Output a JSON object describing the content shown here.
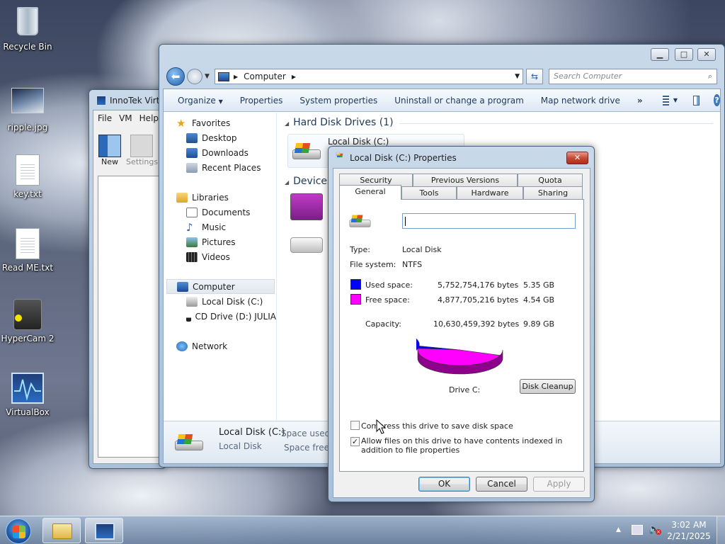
{
  "desktop": {
    "icons": [
      {
        "name": "Recycle Bin"
      },
      {
        "name": "ripple.jpg"
      },
      {
        "name": "key.txt"
      },
      {
        "name": "Read ME.txt"
      },
      {
        "name": "HyperCam 2"
      },
      {
        "name": "VirtualBox"
      }
    ]
  },
  "vbox": {
    "title": "InnoTek Virt",
    "menu": [
      "File",
      "VM",
      "Help"
    ],
    "toolbar": [
      "New",
      "Settings"
    ]
  },
  "explorer": {
    "address": [
      "Computer"
    ],
    "search_placeholder": "Search Computer",
    "toolbar": [
      "Organize",
      "Properties",
      "System properties",
      "Uninstall or change a program",
      "Map network drive"
    ],
    "more": "»",
    "nav": {
      "favorites": "Favorites",
      "favorites_items": [
        "Desktop",
        "Downloads",
        "Recent Places"
      ],
      "libraries": "Libraries",
      "libraries_items": [
        "Documents",
        "Music",
        "Pictures",
        "Videos"
      ],
      "computer": "Computer",
      "computer_items": [
        "Local Disk (C:)",
        "CD Drive (D:) JULIA"
      ],
      "network": "Network"
    },
    "groups": {
      "hdd": "Hard Disk Drives (1)",
      "devices": "Devices"
    },
    "drive_label": "Local Disk (C:)",
    "details": {
      "name": "Local Disk (C:)",
      "type": "Local Disk",
      "space_used_label": "Space used:",
      "space_free_label": "Space free:"
    }
  },
  "dialog": {
    "title": "Local Disk (C:) Properties",
    "tabs_row1": [
      "Security",
      "Previous Versions",
      "Quota"
    ],
    "tabs_row2": [
      "General",
      "Tools",
      "Hardware",
      "Sharing"
    ],
    "name_value": "",
    "type_label": "Type:",
    "type_value": "Local Disk",
    "fs_label": "File system:",
    "fs_value": "NTFS",
    "used_label": "Used space:",
    "used_bytes": "5,752,754,176 bytes",
    "used_gb": "5.35 GB",
    "free_label": "Free space:",
    "free_bytes": "4,877,705,216 bytes",
    "free_gb": "4.54 GB",
    "cap_label": "Capacity:",
    "cap_bytes": "10,630,459,392 bytes",
    "cap_gb": "9.89 GB",
    "used_fraction": 0.541,
    "used_color": "#0000ff",
    "free_color": "#ff00ff",
    "drive_caption": "Drive C:",
    "cleanup": "Disk Cleanup",
    "compress_label": "Compress this drive to save disk space",
    "compress_checked": false,
    "index_label": "Allow files on this drive to have contents indexed in addition to file properties",
    "index_checked": true,
    "ok": "OK",
    "cancel": "Cancel",
    "apply": "Apply"
  },
  "taskbar": {
    "time": "3:02 AM",
    "date": "2/21/2025"
  }
}
